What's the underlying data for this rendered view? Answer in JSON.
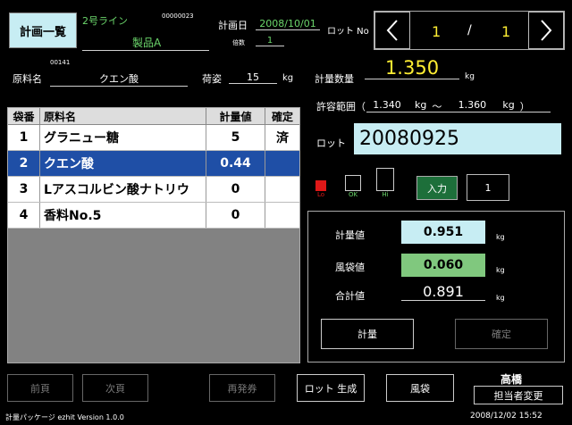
{
  "header": {
    "menu_label": "計画一覧",
    "line_name": "2号ライン",
    "code": "00000023",
    "product": "製品A",
    "plan_date_label": "計画日",
    "plan_date": "2008/10/01",
    "times_label": "倍数",
    "times_value": "1",
    "lot_no_label": "ロット No",
    "page_current": "1",
    "page_sep": "/",
    "page_total": "1"
  },
  "material": {
    "code": "00141",
    "label": "原料名",
    "value": "クエン酸",
    "pack_label": "荷姿",
    "pack_value": "15",
    "pack_unit": "kg"
  },
  "quantity": {
    "label": "計量数量",
    "value": "1.350",
    "unit": "kg",
    "range_label": "許容範囲（",
    "range_low": "1.340",
    "range_unit1": "kg",
    "range_sep": "～",
    "range_high": "1.360",
    "range_unit2": "kg",
    "range_close": "）"
  },
  "table": {
    "headers": [
      "袋番",
      "原料名",
      "計量値",
      "確定"
    ],
    "rows": [
      {
        "no": "1",
        "name": "グラニュー糖",
        "value": "5",
        "done": "済"
      },
      {
        "no": "2",
        "name": "クエン酸",
        "value": "0.44",
        "done": ""
      },
      {
        "no": "3",
        "name": "Lアスコルビン酸ナトリウ",
        "value": "0",
        "done": ""
      },
      {
        "no": "4",
        "name": "香料No.5",
        "value": "0",
        "done": ""
      }
    ]
  },
  "lot": {
    "label": "ロット",
    "value": "20080925"
  },
  "indicators": {
    "lo": "Lo",
    "ok": "OK",
    "hi": "Hi",
    "input_label": "入力",
    "input_value": "1"
  },
  "panel": {
    "weight_label": "計量値",
    "weight_value": "0.951",
    "bag_label": "風袋値",
    "bag_value": "0.060",
    "total_label": "合計値",
    "total_value": "0.891",
    "unit": "kg",
    "weigh_button": "計量",
    "confirm_button": "確定"
  },
  "footer": {
    "prev_page": "前頁",
    "next_page": "次頁",
    "reissue": "再発券",
    "lot_gen": "ロット 生成",
    "bag": "風袋",
    "operator_name": "高橋",
    "operator_change": "担当者変更",
    "version": "計量パッケージ ezhit Version 1.0.0",
    "datetime": "2008/12/02 15:52"
  },
  "colors": {
    "accent_light_blue": "#c7edf3",
    "selection_blue": "#1f4fa6",
    "tare_green": "#80c87e",
    "input_green": "#1d6f3a",
    "highlight_yellow": "#ffee33",
    "lo_red": "#e01818"
  }
}
